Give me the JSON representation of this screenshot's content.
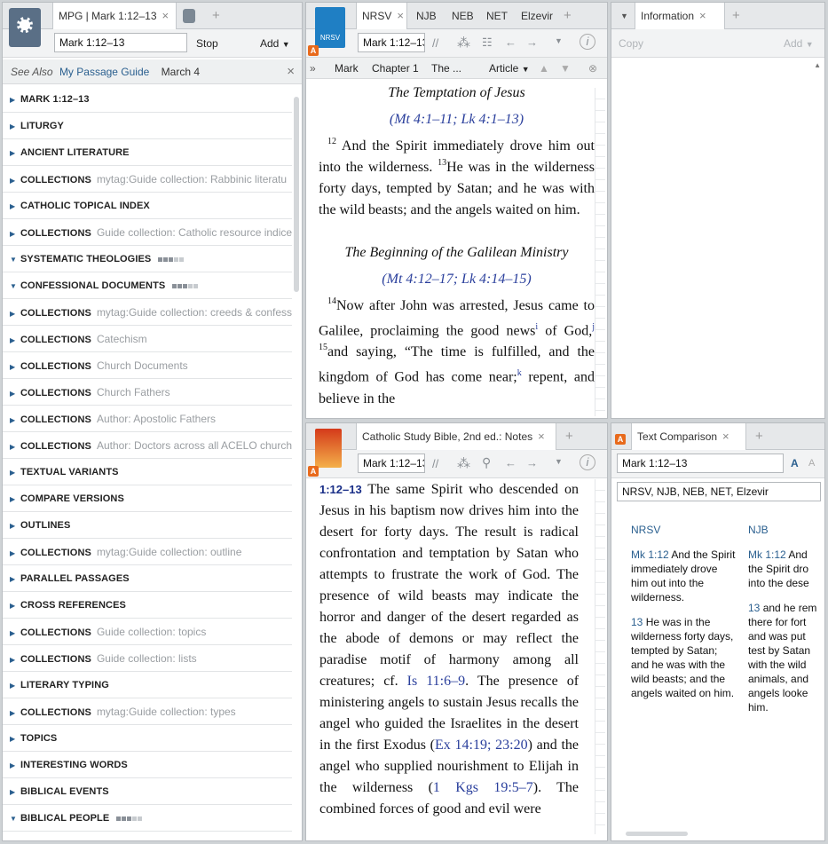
{
  "left": {
    "tab_label": "MPG | Mark 1:12–13",
    "reference": "Mark 1:12–13",
    "stop": "Stop",
    "add": "Add",
    "see_also_prefix": "See Also",
    "see_also_link": "My Passage Guide",
    "see_also_date": "March 4",
    "rows": [
      {
        "h": "MARK 1:12–13",
        "s": "",
        "open": false
      },
      {
        "h": "LITURGY",
        "s": "",
        "open": false
      },
      {
        "h": "ANCIENT LITERATURE",
        "s": "",
        "open": false
      },
      {
        "h": "COLLECTIONS",
        "s": "mytag:Guide collection: Rabbinic literatu",
        "open": false
      },
      {
        "h": "CATHOLIC TOPICAL INDEX",
        "s": "",
        "open": false
      },
      {
        "h": "COLLECTIONS",
        "s": "Guide collection: Catholic resource indice",
        "open": false
      },
      {
        "h": "SYSTEMATIC THEOLOGIES",
        "s": "",
        "open": true,
        "dots": true
      },
      {
        "h": "CONFESSIONAL DOCUMENTS",
        "s": "",
        "open": true,
        "dots": true
      },
      {
        "h": "COLLECTIONS",
        "s": "mytag:Guide collection: creeds & confess",
        "open": false
      },
      {
        "h": "COLLECTIONS",
        "s": "Catechism",
        "open": false
      },
      {
        "h": "COLLECTIONS",
        "s": "Church Documents",
        "open": false
      },
      {
        "h": "COLLECTIONS",
        "s": "Church Fathers",
        "open": false
      },
      {
        "h": "COLLECTIONS",
        "s": "Author: Apostolic Fathers",
        "open": false
      },
      {
        "h": "COLLECTIONS",
        "s": "Author: Doctors across all ACELO churche",
        "open": false
      },
      {
        "h": "TEXTUAL VARIANTS",
        "s": "",
        "open": false
      },
      {
        "h": "COMPARE VERSIONS",
        "s": "",
        "open": false
      },
      {
        "h": "OUTLINES",
        "s": "",
        "open": false
      },
      {
        "h": "COLLECTIONS",
        "s": "mytag:Guide collection: outline",
        "open": false
      },
      {
        "h": "PARALLEL PASSAGES",
        "s": "",
        "open": false
      },
      {
        "h": "CROSS REFERENCES",
        "s": "",
        "open": false
      },
      {
        "h": "COLLECTIONS",
        "s": "Guide collection: topics",
        "open": false
      },
      {
        "h": "COLLECTIONS",
        "s": "Guide collection: lists",
        "open": false
      },
      {
        "h": "LITERARY TYPING",
        "s": "",
        "open": false
      },
      {
        "h": "COLLECTIONS",
        "s": "mytag:Guide collection: types",
        "open": false
      },
      {
        "h": "TOPICS",
        "s": "",
        "open": false
      },
      {
        "h": "INTERESTING WORDS",
        "s": "",
        "open": false
      },
      {
        "h": "BIBLICAL EVENTS",
        "s": "",
        "open": false
      },
      {
        "h": "BIBLICAL PEOPLE",
        "s": "",
        "open": true,
        "dots": true
      }
    ]
  },
  "bible": {
    "cover_label": "NRSV",
    "tabs": [
      "NRSV",
      "NJB",
      "NEB",
      "NET",
      "Elzevir"
    ],
    "reference": "Mark 1:12–13",
    "crumbs": [
      "Mark",
      "Chapter 1",
      "The ..."
    ],
    "article": "Article",
    "heading1": "The Temptation of Jesus",
    "cref1": "(Mt 4:1–11; Lk 4:1–13)",
    "v12": "12",
    "t12": "And the Spirit immediately drove him out into the wilderness.",
    "v13": "13",
    "t13": "He was in the wilderness forty days, tempted by Satan; and he was with the wild beasts; and the angels waited on him.",
    "heading2": "The Beginning of the Galilean Ministry",
    "cref2": "(Mt 4:12–17; Lk 4:14–15)",
    "v14": "14",
    "t14a": "Now after John was arrested, Jesus came to Galilee, proclaiming the good news",
    "fn_i": "i",
    "t14b": "of God,",
    "fn_j": "j",
    "v15": "15",
    "t15a": "and saying, “The time is fulfilled, and the kingdom of God has come near;",
    "fn_k": "k",
    "t15b": "repent, and believe in the"
  },
  "notes": {
    "tab_label": "Catholic Study Bible, 2nd ed.: Notes",
    "reference": "Mark 1:12–13",
    "ref": "1:12–13",
    "t1": "The same Spirit who descended on Jesus in his baptism now drives him into the desert for forty days. The result is radical confrontation and temptation by Satan who attempts to frustrate the work of God. The presence of wild beasts may indicate the horror and danger of the desert regarded as the abode of demons or may reflect the paradise motif of harmony among all creatures; cf.",
    "l1": "Is 11:6–9",
    "t2": ". The presence of ministering angels to sustain Jesus recalls the angel who guided the Israelites in the desert in the first Exodus (",
    "l2": "Ex 14:19; 23:20",
    "t3": ") and the angel who supplied nourishment to Elijah in the wilderness (",
    "l3": "1 Kgs 19:5–7",
    "t4": "). The combined forces of good and evil were"
  },
  "info": {
    "tab_label": "Information",
    "copy": "Copy",
    "add": "Add"
  },
  "compare": {
    "tab_label": "Text Comparison",
    "reference": "Mark 1:12–13",
    "versions": "NRSV, NJB, NEB, NET, Elzevir",
    "col1_head": "NRSV",
    "col1_v12": "Mk 1:12",
    "col1_t12": "And the Spirit immediately drove him out into the wilderness.",
    "col1_v13": "13",
    "col1_t13": "He was in the wilderness forty days, tempted by Satan; and he was with the wild beasts; and the angels waited on him.",
    "col2_head": "NJB",
    "col2_v12": "Mk 1:12",
    "col2_t12": "And the Spirit dro into the dese",
    "col2_v13": "13",
    "col2_t13": "and he rem there for fort and was put test by Satan with the wild animals, and angels looke him."
  }
}
